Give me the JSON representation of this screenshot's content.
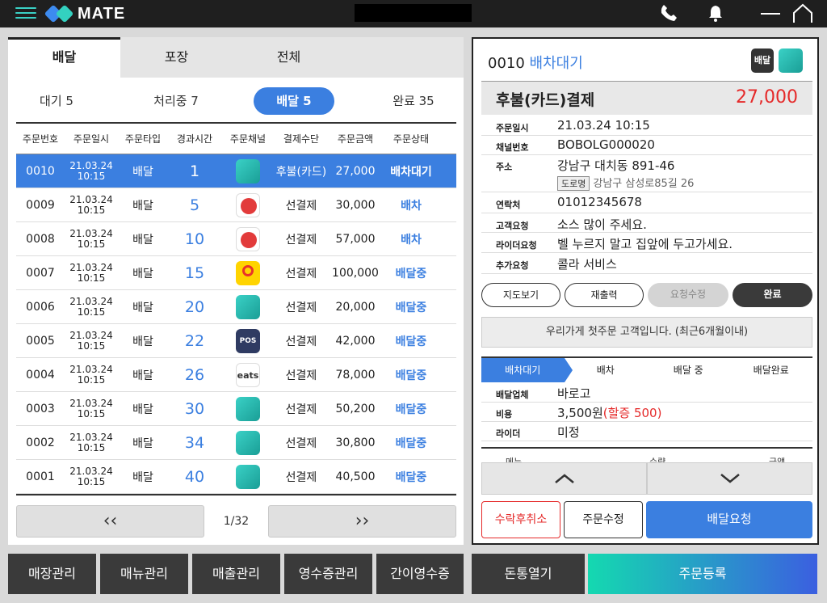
{
  "topbar": {
    "logo_text": "MATE",
    "icons": [
      "menu-icon",
      "phone-icon",
      "bell-icon",
      "minimize-icon",
      "home-icon"
    ]
  },
  "order_tabs": [
    "배달",
    "포장",
    "전체"
  ],
  "status_tabs": [
    {
      "label": "대기 5"
    },
    {
      "label": "처리중 7"
    },
    {
      "label": "배달 5"
    },
    {
      "label": "완료 35"
    }
  ],
  "table": {
    "headers": [
      "주문번호",
      "주문일시",
      "주문타입",
      "경과시간",
      "주문채널",
      "결제수단",
      "주문금액",
      "주문상태"
    ],
    "rows": [
      {
        "no": "0010",
        "date": "21.03.24",
        "time": "10:15",
        "type": "배달",
        "elapsed": "1",
        "channel": "baemin",
        "pay": "후불(카드)",
        "amount": "27,000",
        "status": "배차대기"
      },
      {
        "no": "0009",
        "date": "21.03.24",
        "time": "10:15",
        "type": "배달",
        "elapsed": "5",
        "channel": "yogiyo",
        "pay": "선결제",
        "amount": "30,000",
        "status": "배차"
      },
      {
        "no": "0008",
        "date": "21.03.24",
        "time": "10:15",
        "type": "배달",
        "elapsed": "10",
        "channel": "yogiyo",
        "pay": "선결제",
        "amount": "57,000",
        "status": "배차"
      },
      {
        "no": "0007",
        "date": "21.03.24",
        "time": "10:15",
        "type": "배달",
        "elapsed": "15",
        "channel": "wemakeprice",
        "pay": "선결제",
        "amount": "100,000",
        "status": "배달중"
      },
      {
        "no": "0006",
        "date": "21.03.24",
        "time": "10:15",
        "type": "배달",
        "elapsed": "20",
        "channel": "baemin",
        "pay": "선결제",
        "amount": "20,000",
        "status": "배달중"
      },
      {
        "no": "0005",
        "date": "21.03.24",
        "time": "10:15",
        "type": "배달",
        "elapsed": "22",
        "channel": "pos",
        "pay": "선결제",
        "amount": "42,000",
        "status": "배달중"
      },
      {
        "no": "0004",
        "date": "21.03.24",
        "time": "10:15",
        "type": "배달",
        "elapsed": "26",
        "channel": "eats",
        "pay": "선결제",
        "amount": "78,000",
        "status": "배달중"
      },
      {
        "no": "0003",
        "date": "21.03.24",
        "time": "10:15",
        "type": "배달",
        "elapsed": "30",
        "channel": "baemin",
        "pay": "선결제",
        "amount": "50,200",
        "status": "배달중"
      },
      {
        "no": "0002",
        "date": "21.03.24",
        "time": "10:15",
        "type": "배달",
        "elapsed": "34",
        "channel": "baemin",
        "pay": "선결제",
        "amount": "30,800",
        "status": "배달중"
      },
      {
        "no": "0001",
        "date": "21.03.24",
        "time": "10:15",
        "type": "배달",
        "elapsed": "40",
        "channel": "baemin",
        "pay": "선결제",
        "amount": "40,500",
        "status": "배달중"
      }
    ]
  },
  "channel_labels": {
    "pos": "POS",
    "eats": "eats"
  },
  "pager": {
    "prev": "‹‹",
    "next": "››",
    "page": "1/32"
  },
  "detail": {
    "order_no": "0010",
    "status": "배차대기",
    "badge_type": "배달",
    "payment": "후불(카드)결제",
    "amount": "27,000",
    "fields": {
      "order_time_label": "주문일시",
      "order_time": "21.03.24 10:15",
      "channel_no_label": "채널번호",
      "channel_no": "BOBOLG000020",
      "address_label": "주소",
      "address": "강남구 대치동 891-46",
      "road_tag": "도로명",
      "road_address": "강남구 삼성로85길 26",
      "contact_label": "연락처",
      "contact": "01012345678",
      "customer_req_label": "고객요청",
      "customer_req": "소스 많이 주세요.",
      "rider_req_label": "라이더요청",
      "rider_req": "벨 누르지 말고 집앞에 두고가세요.",
      "extra_req_label": "추가요청",
      "extra_req": "콜라 서비스"
    },
    "actions": [
      "지도보기",
      "재출력",
      "요청수정",
      "완료"
    ],
    "notice": "우리가게 첫주문 고객입니다. (최근6개월이내)",
    "steps": [
      "배차대기",
      "배차",
      "배달 중",
      "배달완료"
    ],
    "delivery": {
      "company_label": "배달업체",
      "company": "바로고",
      "fee_label": "비용",
      "fee": "3,500원",
      "surcharge": "(할증 500)",
      "rider_label": "라이더",
      "rider": "미정"
    },
    "menu_headers": [
      "메뉴",
      "수량",
      "금액"
    ],
    "buttons": {
      "cancel": "수락후취소",
      "edit": "주문수정",
      "request": "배달요청"
    }
  },
  "bottom_nav": [
    "매장관리",
    "매뉴관리",
    "매출관리",
    "영수증관리",
    "간이영수증",
    "돈통열기",
    "주문등록"
  ],
  "colors": {
    "accent": "#3b7fe0",
    "danger": "#e52a2a",
    "teal": "#3ad1c6"
  }
}
